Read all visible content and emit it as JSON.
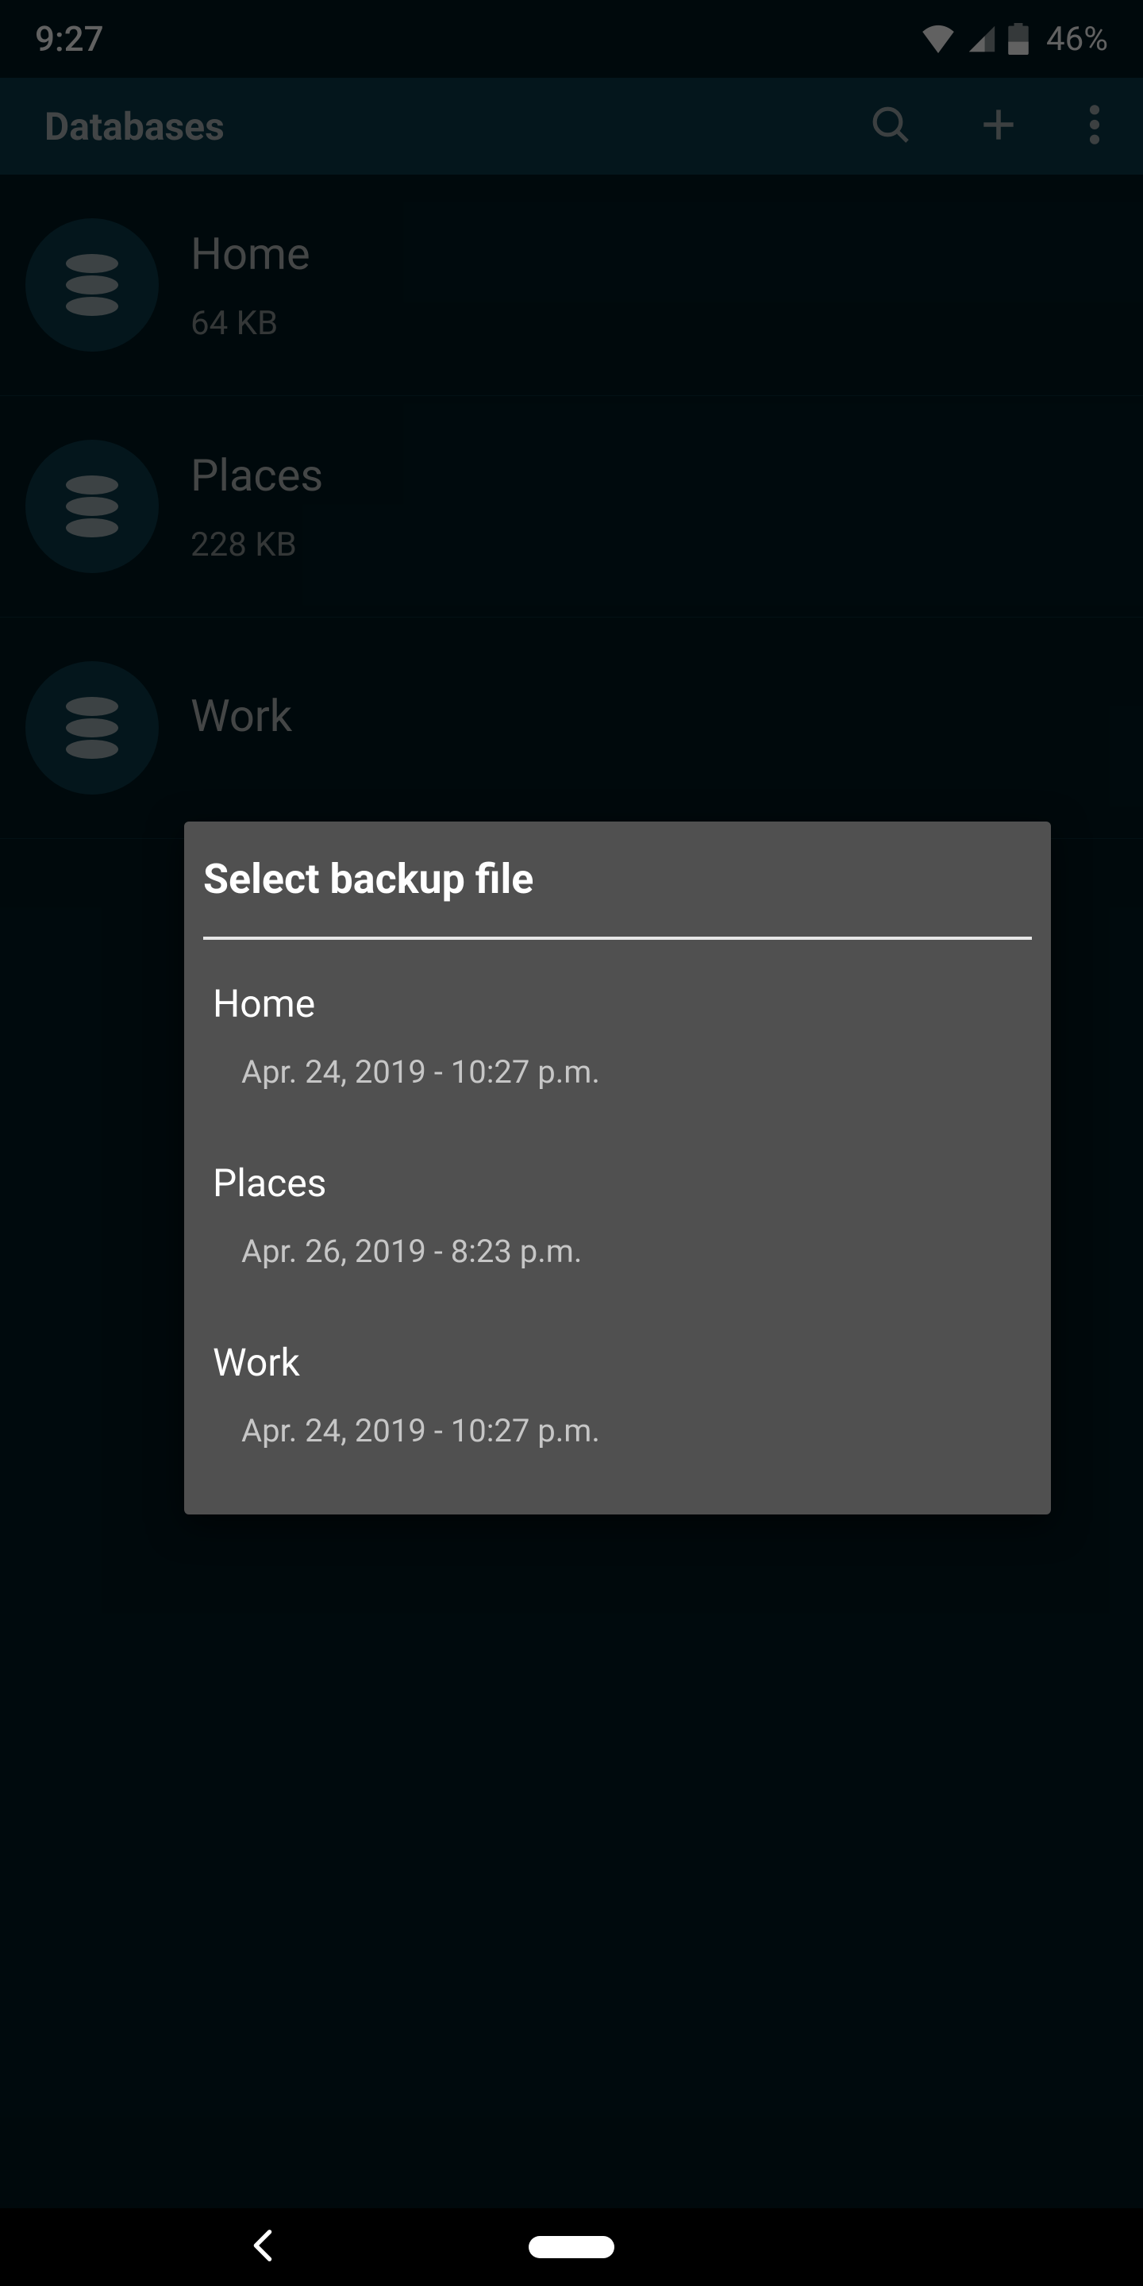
{
  "status": {
    "time": "9:27",
    "battery": "46%"
  },
  "appbar": {
    "title": "Databases"
  },
  "databases": [
    {
      "name": "Home",
      "size": "64 KB"
    },
    {
      "name": "Places",
      "size": "228 KB"
    },
    {
      "name": "Work",
      "size": ""
    }
  ],
  "dialog": {
    "title": "Select backup file",
    "items": [
      {
        "name": "Home",
        "meta": "Apr. 24, 2019 - 10:27 p.m."
      },
      {
        "name": "Places",
        "meta": "Apr. 26, 2019 - 8:23 p.m."
      },
      {
        "name": "Work",
        "meta": "Apr. 24, 2019 - 10:27 p.m."
      }
    ]
  }
}
